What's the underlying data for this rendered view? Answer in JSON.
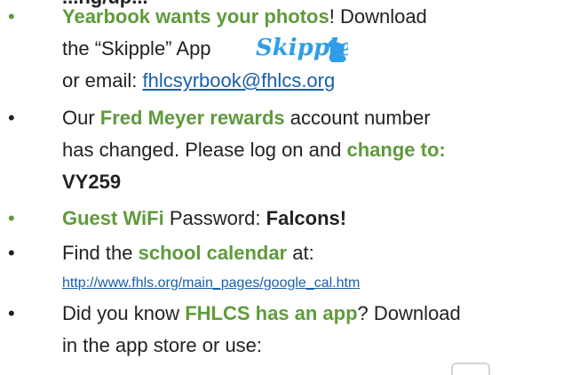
{
  "top_cut_text": "...ng/up...",
  "bullets": [
    {
      "marker": "•",
      "lines": [
        {
          "strong_green": "Yearbook wants your photos",
          "rest": "!  Download"
        },
        {
          "text": "the “Skipple” App"
        },
        {
          "prefix": "or email: ",
          "link": "fhlcsyrbook@fhlcs.org"
        }
      ]
    },
    {
      "marker": "•",
      "lines": [
        {
          "text_before": "Our ",
          "strong_green": "Fred Meyer rewards",
          "text_after": " account number"
        },
        {
          "text_before": "has changed.  Please log on and ",
          "strong_green": "change to:"
        },
        {
          "strong_dark": "VY259"
        }
      ]
    },
    {
      "marker": "•",
      "lines": [
        {
          "strong_green": "Guest WiFi",
          "text_middle": " Password: ",
          "strong_dark": "Falcons!"
        }
      ]
    },
    {
      "marker": "•",
      "lines": [
        {
          "text_before": "Find the ",
          "strong_green": "school calendar",
          "text_after": " at:"
        },
        {
          "link": "http://www.fhls.org/main_pages/google_cal.htm"
        }
      ]
    },
    {
      "marker": "•",
      "lines": [
        {
          "text_before": "Did you know ",
          "strong_green": "FHLCS has an app",
          "text_after": "?  Download"
        },
        {
          "text": "in the app store or use:"
        }
      ]
    }
  ],
  "logo": {
    "text": "Skipple",
    "color": "#2f9ee8",
    "icon": "squirrel-icon"
  },
  "colors": {
    "accent_green": "#5f9a3b",
    "link_blue": "#1a5fa8",
    "text_dark": "#222222"
  }
}
